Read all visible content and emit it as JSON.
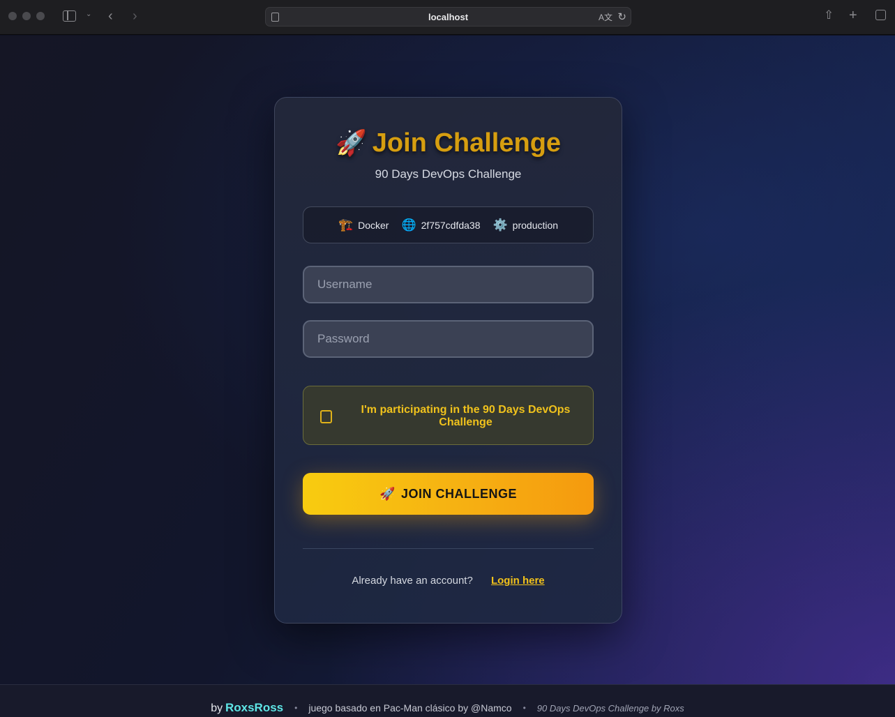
{
  "browser": {
    "url": "localhost",
    "icons": [
      "sidebar-icon",
      "chevron-down-icon",
      "back-icon",
      "forward-icon",
      "page-settings-icon",
      "translate-icon",
      "reload-icon",
      "share-icon",
      "new-tab-icon",
      "tab-overview-icon"
    ]
  },
  "card": {
    "title": "Join Challenge",
    "title_icon": "🚀",
    "subtitle": "90 Days DevOps Challenge",
    "info": [
      {
        "icon": "🏗️",
        "label": "Docker"
      },
      {
        "icon": "🌐",
        "label": "2f757cdfda38"
      },
      {
        "icon": "⚙️",
        "label": "production"
      }
    ],
    "username_placeholder": "Username",
    "password_placeholder": "Password",
    "participation_label": "I'm participating in the 90 Days DevOps Challenge",
    "join_button": {
      "icon": "🚀",
      "label": "JOIN CHALLENGE"
    },
    "login_prompt": "Already have an account?",
    "login_link": "Login here"
  },
  "footer": {
    "by": "by",
    "author": "RoxsRoss",
    "based_on": "juego basado en Pac-Man clásico by @Namco",
    "credit": "90 Days DevOps Challenge by Roxs",
    "separator": "•"
  },
  "colors": {
    "accent": "#f8cc10",
    "title": "#d69e10",
    "author": "#5ee6e6"
  }
}
